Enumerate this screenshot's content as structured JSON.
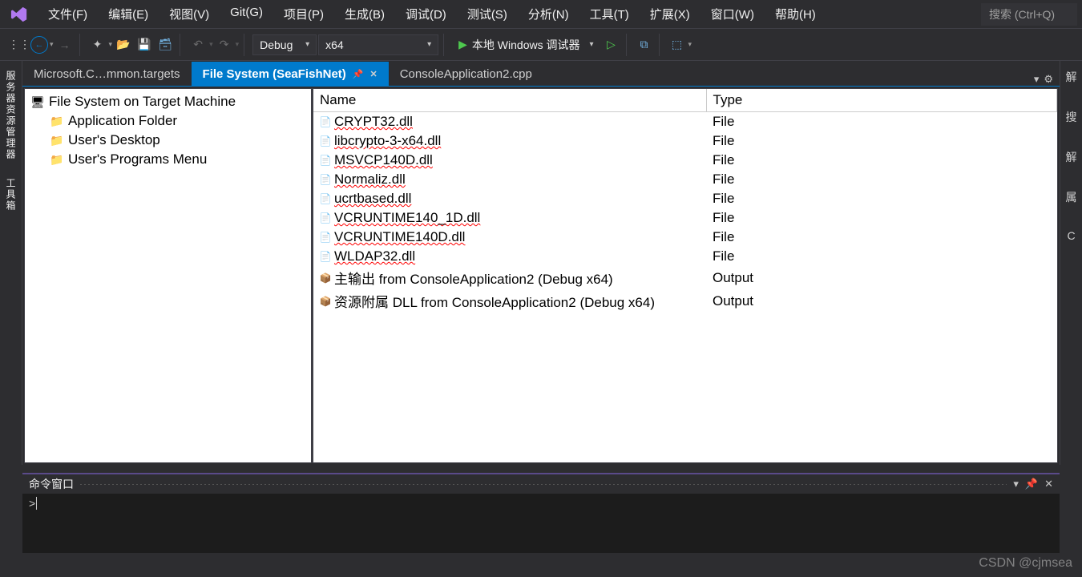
{
  "menu": {
    "items": [
      "文件(F)",
      "编辑(E)",
      "视图(V)",
      "Git(G)",
      "项目(P)",
      "生成(B)",
      "调试(D)",
      "测试(S)",
      "分析(N)",
      "工具(T)",
      "扩展(X)",
      "窗口(W)",
      "帮助(H)"
    ]
  },
  "search": {
    "placeholder": "搜索 (Ctrl+Q)"
  },
  "toolbar": {
    "config": "Debug",
    "platform": "x64",
    "debugger": "本地 Windows 调试器"
  },
  "sidebar_left": {
    "tab1": "服务器资源管理器",
    "tab2": "工具箱"
  },
  "tabs": [
    {
      "label": "Microsoft.C…mmon.targets",
      "active": false
    },
    {
      "label": "File System (SeaFishNet)",
      "active": true
    },
    {
      "label": "ConsoleApplication2.cpp",
      "active": false
    }
  ],
  "tree": {
    "root": "File System on Target Machine",
    "children": [
      "Application Folder",
      "User's Desktop",
      "User's Programs Menu"
    ]
  },
  "file_list": {
    "columns": [
      "Name",
      "Type"
    ],
    "rows": [
      {
        "name": "CRYPT32.dll",
        "type": "File",
        "wavy": true,
        "icon": "doc"
      },
      {
        "name": "libcrypto-3-x64.dll",
        "type": "File",
        "wavy": true,
        "icon": "doc"
      },
      {
        "name": "MSVCP140D.dll",
        "type": "File",
        "wavy": true,
        "icon": "doc"
      },
      {
        "name": "Normaliz.dll",
        "type": "File",
        "wavy": true,
        "icon": "doc"
      },
      {
        "name": "ucrtbased.dll",
        "type": "File",
        "wavy": true,
        "icon": "doc"
      },
      {
        "name": "VCRUNTIME140_1D.dll",
        "type": "File",
        "wavy": true,
        "icon": "doc"
      },
      {
        "name": "VCRUNTIME140D.dll",
        "type": "File",
        "wavy": true,
        "icon": "doc"
      },
      {
        "name": "WLDAP32.dll",
        "type": "File",
        "wavy": true,
        "icon": "doc"
      },
      {
        "name": "主输出 from ConsoleApplication2 (Debug x64)",
        "type": "Output",
        "wavy": false,
        "icon": "out"
      },
      {
        "name": "资源附属 DLL from ConsoleApplication2 (Debug x64)",
        "type": "Output",
        "wavy": false,
        "icon": "out"
      }
    ]
  },
  "sidebar_right": {
    "items": [
      "解",
      "搜",
      "解",
      "属",
      "C"
    ]
  },
  "bottom": {
    "title": "命令窗口",
    "prompt": ">"
  },
  "watermark": "CSDN @cjmsea"
}
